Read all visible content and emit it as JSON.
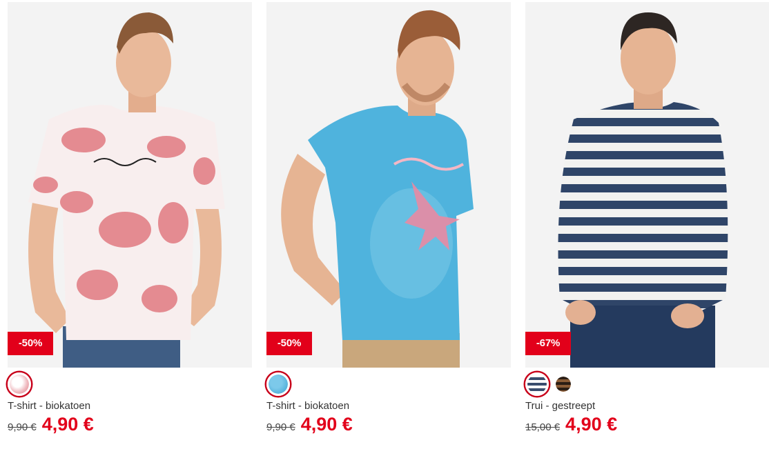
{
  "colors": {
    "accent": "#e2001a",
    "text": "#333333",
    "photo_bg": "#f2f2f2"
  },
  "products": [
    {
      "badge": "-50%",
      "swatches": [
        {
          "name": "white-red-tie-dye",
          "color": "#f1c9cd",
          "selected": true
        }
      ],
      "title": "T-shirt - biokatoen",
      "old_price": "9,90 €",
      "new_price": "4,90 €"
    },
    {
      "badge": "-50%",
      "swatches": [
        {
          "name": "light-blue",
          "color": "#48a9d1",
          "selected": true
        }
      ],
      "title": "T-shirt - biokatoen",
      "old_price": "9,90 €",
      "new_price": "4,90 €"
    },
    {
      "badge": "-67%",
      "swatches": [
        {
          "name": "navy-white-stripe",
          "color": "#3a4d6e",
          "selected": true
        },
        {
          "name": "brown-black-stripe",
          "color": "#6b4a2f",
          "selected": false
        }
      ],
      "title": "Trui - gestreept",
      "old_price": "15,00 €",
      "new_price": "4,90 €"
    }
  ]
}
